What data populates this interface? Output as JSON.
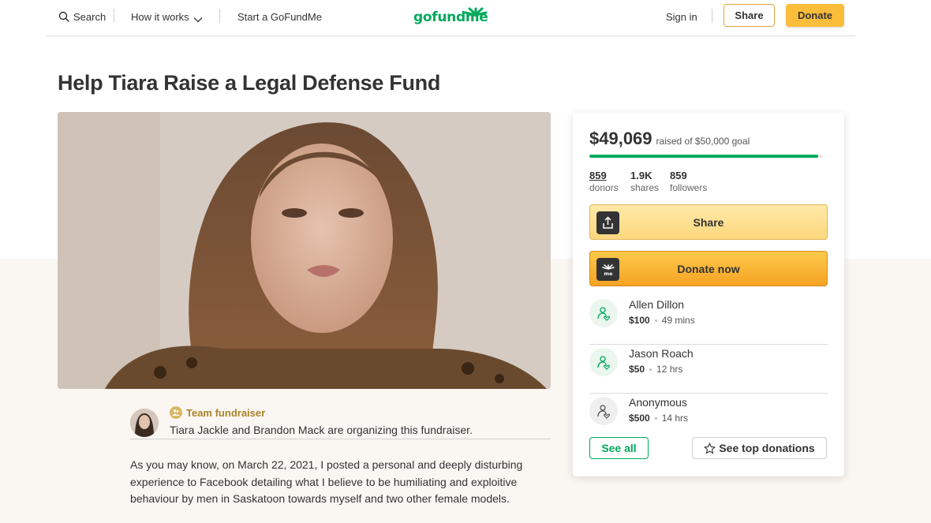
{
  "header": {
    "search_label": "Search",
    "how_it_works_label": "How it works",
    "start_label": "Start a GoFundMe",
    "logo_text": "gofundme",
    "sign_in_label": "Sign in",
    "share_label": "Share",
    "donate_label": "Donate"
  },
  "page_title": "Help Tiara Raise a Legal Defense Fund",
  "organizer": {
    "badge": "Team fundraiser",
    "text": "Tiara Jackle and Brandon Mack are organizing this fundraiser."
  },
  "story": "As you may know, on March 22, 2021, I posted a personal and deeply disturbing experience to Facebook detailing what I believe to be humiliating and exploitive behaviour by men in Saskatoon towards myself and two other female models.",
  "campaign": {
    "raised": "$49,069",
    "goal_text": "raised of $50,000 goal",
    "progress_fraction": 0.981,
    "stats": [
      {
        "value": "859",
        "label": "donors"
      },
      {
        "value": "1.9K",
        "label": "shares"
      },
      {
        "value": "859",
        "label": "followers"
      }
    ],
    "share_button": "Share",
    "donate_button": "Donate now",
    "donations": [
      {
        "name": "Allen Dillon",
        "amount": "$100",
        "time": "49 mins"
      },
      {
        "name": "Jason Roach",
        "amount": "$50",
        "time": "12 hrs"
      },
      {
        "name": "Anonymous",
        "amount": "$500",
        "time": "14 hrs"
      }
    ],
    "see_all_label": "See all",
    "see_top_label": "See top donations"
  },
  "colors": {
    "brand_green": "#02a95c",
    "donate_yellow": "#fbbd3a",
    "team_gold": "#a8842b"
  }
}
